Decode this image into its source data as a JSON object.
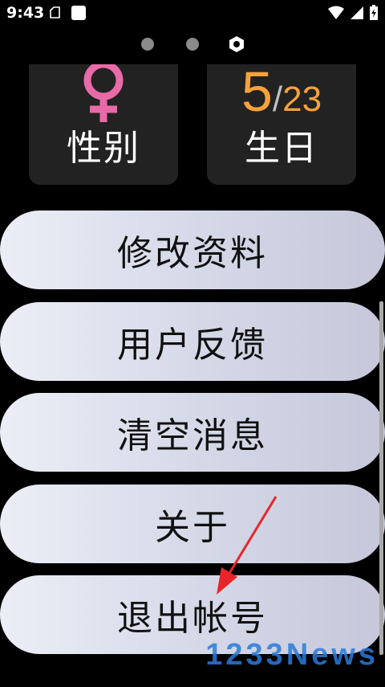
{
  "status": {
    "time": "9:43"
  },
  "pager": {
    "count": 3,
    "active_index": 2
  },
  "cards": {
    "gender": {
      "label": "性别",
      "icon": "female-symbol-icon",
      "color": "#e86aa6"
    },
    "birthday": {
      "label": "生日",
      "month": "5",
      "separator": "/",
      "day": "23",
      "color": "#f7a23a"
    }
  },
  "menu": {
    "items": [
      {
        "label": "修改资料"
      },
      {
        "label": "用户反馈"
      },
      {
        "label": "清空消息"
      },
      {
        "label": "关于"
      },
      {
        "label": "退出帐号"
      }
    ]
  },
  "watermark": {
    "text": "1233News"
  },
  "annotation": {
    "type": "red-arrow",
    "color": "#e8262a"
  }
}
